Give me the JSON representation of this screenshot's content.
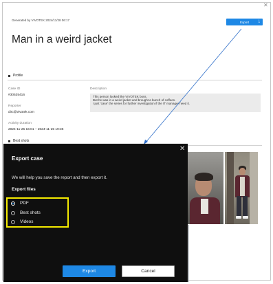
{
  "report": {
    "generated": "Generated by VIVOTEK 2024/11/28 06:17",
    "export_label": "Export",
    "title": "Man in a weird jacket",
    "profile_label": "Profile",
    "case_id_label": "Case ID",
    "case_id": "#30535416",
    "reporter_label": "Reporter",
    "reporter": "dirc@vivotek.com",
    "activity_label": "Activity duration",
    "activity": "2024-11-25 16:01 – 2024-11-25 19:36",
    "description_label": "Description",
    "description_lines": [
      "This person looked like VIVOTEK boss.",
      "But he was in a weird jacket and brought a bunch of coffees.",
      "I just 'case' the series for further investigation if the IT manager need it."
    ],
    "best_shots_label": "Best shots"
  },
  "modal": {
    "title": "Export case",
    "message": "We will help you save the report and then export it.",
    "files_label": "Export files",
    "options": [
      {
        "label": "PDF",
        "selected": true
      },
      {
        "label": "Best shots",
        "selected": false
      },
      {
        "label": "Videos",
        "selected": false
      }
    ],
    "export_button": "Export",
    "cancel_button": "Cancel"
  },
  "colors": {
    "accent": "#1e88e5",
    "highlight": "#f5eb00",
    "modal_bg": "#0f0f0f"
  },
  "icons": [
    "close-icon",
    "download-icon",
    "radio-icon"
  ]
}
